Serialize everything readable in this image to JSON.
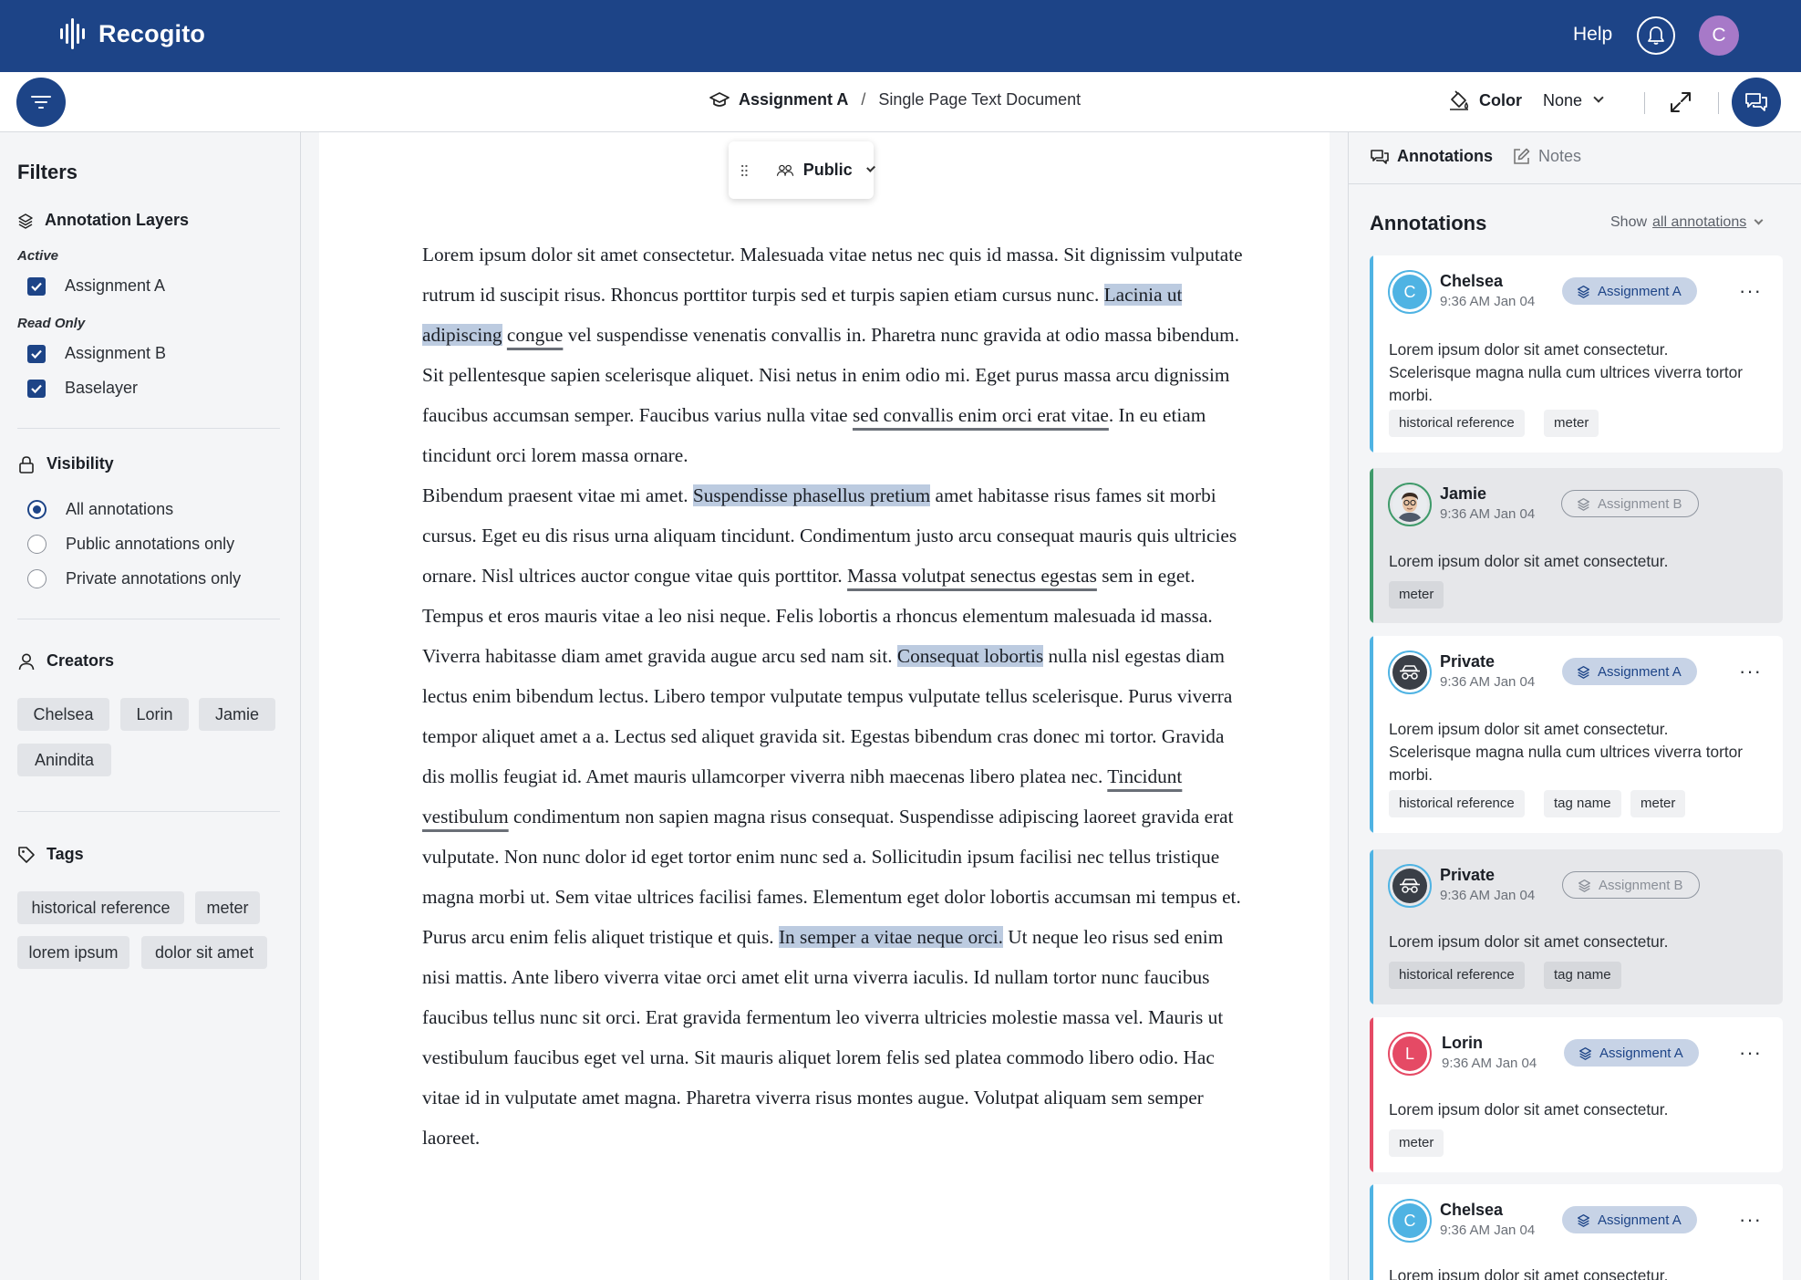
{
  "app": {
    "name": "Recogito",
    "help_label": "Help",
    "user_initial": "C",
    "user_avatar_color": "#a779c8",
    "brand_color": "#1d4487"
  },
  "breadcrumb": {
    "assignment": "Assignment A",
    "separator": "/",
    "document": "Single Page Text Document"
  },
  "color_control": {
    "label": "Color",
    "value": "None"
  },
  "filters": {
    "title": "Filters",
    "layers": {
      "heading": "Annotation Layers",
      "active_label": "Active",
      "active_items": [
        "Assignment A"
      ],
      "readonly_label": "Read Only",
      "readonly_items": [
        "Assignment B",
        "Baselayer"
      ]
    },
    "visibility": {
      "heading": "Visibility",
      "options": [
        "All annotations",
        "Public annotations only",
        "Private annotations only"
      ],
      "selected": "All annotations"
    },
    "creators": {
      "heading": "Creators",
      "items": [
        "Chelsea",
        "Lorin",
        "Jamie",
        "Anindita"
      ]
    },
    "tags": {
      "heading": "Tags",
      "items": [
        "historical reference",
        "meter",
        "lorem ipsum",
        "dolor sit amet"
      ]
    }
  },
  "doc_toolbar": {
    "privacy": "Public"
  },
  "document": {
    "p1": {
      "a": "Lorem ipsum dolor sit amet consectetur. Malesuada vitae netus nec quis id massa. Sit dignissim vulputate rutrum id suscipit risus. Rhoncus porttitor turpis sed et turpis sapien etiam cursus nunc. ",
      "hl1": "Lacinia ut adipiscing",
      "b": " ",
      "ul1": "congue",
      "c": " vel suspendisse venenatis convallis in. Pharetra nunc gravida at odio massa bibendum. Sit pellentesque sapien scelerisque aliquet. Nisi netus in enim odio mi. Eget purus massa arcu dignissim faucibus accumsan semper. Faucibus varius nulla vitae ",
      "ul2": "sed convallis enim orci erat vitae",
      "d": ". In eu etiam tincidunt orci lorem massa ornare."
    },
    "p2": {
      "a": "Bibendum praesent vitae mi amet. ",
      "hl1": "Suspendisse phasellus pretium",
      "b": " amet habitasse risus fames sit morbi cursus. Eget eu dis risus urna aliquam tincidunt. Condimentum justo arcu consequat mauris quis ultricies ornare. Nisl ultrices auctor congue vitae quis porttitor. ",
      "ul1": "Massa volutpat senectus egestas",
      "c": " sem in eget. Tempus et eros mauris vitae a leo nisi neque. Felis lobortis a rhoncus elementum malesuada id massa. Viverra habitasse diam amet gravida augue arcu sed nam sit. ",
      "hl2": "Consequat lobortis",
      "d": " nulla nisl egestas diam lectus enim bibendum lectus. Libero tempor vulputate tempus vulputate tellus scelerisque. Purus viverra tempor aliquet amet a a. Lectus sed aliquet gravida sit. Egestas bibendum cras donec mi tortor. Gravida dis mollis feugiat id. Amet mauris ullamcorper viverra nibh maecenas libero platea nec. ",
      "ul2": "Tincidunt vestibulum",
      "e": " condimentum non sapien magna risus consequat. Suspendisse adipiscing laoreet gravida erat vulputate. Non nunc dolor id eget tortor enim nunc sed a. Sollicitudin ipsum facilisi nec tellus tristique magna morbi ut. Sem vitae ultrices facilisi fames. Elementum eget dolor lobortis accumsan mi tempus et. Purus arcu enim felis aliquet tristique et quis. ",
      "hl3": "In semper a vitae neque orci.",
      "f": " Ut neque leo risus sed enim nisi mattis. Ante libero viverra vitae orci amet elit urna viverra iaculis. Id nullam tortor nunc faucibus faucibus tellus nunc sit orci. Erat gravida fermentum leo viverra ultricies molestie massa vel. Mauris ut vestibulum faucibus eget vel urna. Sit mauris aliquet lorem felis sed platea commodo libero odio. Hac vitae id in vulputate amet magna. Pharetra viverra risus montes augue. Volutpat aliquam sem semper laoreet."
    }
  },
  "right_panel": {
    "tab_annotations": "Annotations",
    "tab_notes": "Notes",
    "title": "Annotations",
    "show_prefix": "Show",
    "show_value": "all annotations",
    "cards": [
      {
        "name": "Chelsea",
        "initial": "C",
        "time": "9:36 AM Jan 04",
        "layer": "Assignment A",
        "body": "Lorem ipsum dolor sit amet consectetur. Scelerisque magna nulla cum ultrices viverra tortor morbi.",
        "tags": [
          "historical reference",
          "meter"
        ],
        "accent": "#4fb3e3"
      },
      {
        "name": "Jamie",
        "time": "9:36 AM Jan 04",
        "layer": "Assignment B",
        "body": "Lorem ipsum dolor sit amet consectetur.",
        "tags": [
          "meter"
        ],
        "accent": "#3f9a6a"
      },
      {
        "name": "Private",
        "time": "9:36 AM Jan 04",
        "layer": "Assignment A",
        "body": "Lorem ipsum dolor sit amet consectetur. Scelerisque magna nulla cum ultrices viverra tortor morbi.",
        "tags": [
          "historical reference",
          "tag name",
          "meter"
        ],
        "accent": "#4fb3e3"
      },
      {
        "name": "Private",
        "time": "9:36 AM Jan 04",
        "layer": "Assignment B",
        "body": "Lorem ipsum dolor sit amet consectetur.",
        "tags": [
          "historical reference",
          "tag name"
        ],
        "accent": "#4fb3e3"
      },
      {
        "name": "Lorin",
        "initial": "L",
        "time": "9:36 AM Jan 04",
        "layer": "Assignment A",
        "body": "Lorem ipsum dolor sit amet consectetur.",
        "tags": [
          "meter"
        ],
        "accent": "#e54a65"
      },
      {
        "name": "Chelsea",
        "initial": "C",
        "time": "9:36 AM Jan 04",
        "layer": "Assignment A",
        "body": "Lorem ipsum dolor sit amet consectetur.",
        "tags": [],
        "accent": "#4fb3e3"
      }
    ]
  }
}
